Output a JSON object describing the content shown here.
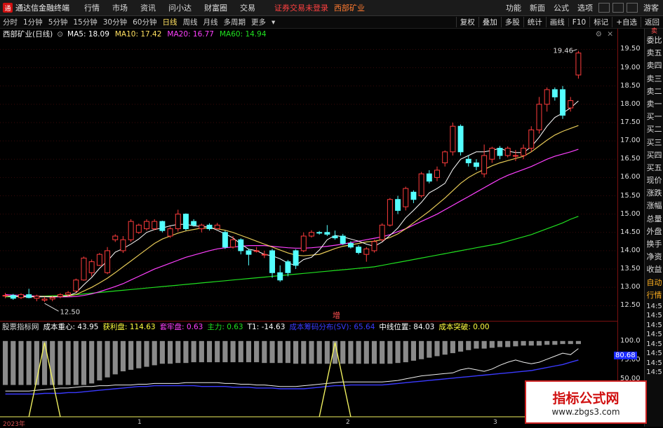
{
  "menubar": {
    "app_title": "通达信金融终端",
    "logo_glyph": "通",
    "items": [
      "行情",
      "市场",
      "资讯",
      "问小达",
      "财富圈",
      "交易"
    ],
    "notice": "证券交易未登录",
    "stock": "西部矿业",
    "right_items": [
      "功能",
      "新面",
      "公式",
      "选项"
    ],
    "guest": "游客"
  },
  "periods": {
    "items": [
      "分时",
      "1分钟",
      "5分钟",
      "15分钟",
      "30分钟",
      "60分钟",
      "日线",
      "周线",
      "月线",
      "多周期",
      "更多"
    ],
    "active_index": 6,
    "tools": [
      "复权",
      "叠加",
      "多股",
      "统计",
      "画线",
      "F10",
      "标记",
      "+自选",
      "返回"
    ]
  },
  "info": {
    "stock_label": "西部矿业(日线)",
    "ma5": "MA5: 18.09",
    "ma10": "MA10: 17.42",
    "ma20": "MA20: 16.77",
    "ma60": "MA60: 14.94",
    "colors": {
      "ma5": "#ffffff",
      "ma10": "#ffe060",
      "ma20": "#ff40ff",
      "ma60": "#20e020"
    }
  },
  "annotations": {
    "high": "19.46",
    "low": "12.50",
    "zeng": "增"
  },
  "y_ticks": [
    "19.50",
    "19.00",
    "18.50",
    "18.00",
    "17.50",
    "17.00",
    "16.50",
    "16.00",
    "15.50",
    "15.00",
    "14.50",
    "14.00",
    "13.50",
    "13.00",
    "12.50"
  ],
  "indicator": {
    "name": "股票指标网",
    "items": [
      {
        "text": "成本重心: 43.95",
        "color": "#ffffff"
      },
      {
        "text": "获利盘: 114.63",
        "color": "#ffff40"
      },
      {
        "text": "套牢盘: 0.63",
        "color": "#ff40ff"
      },
      {
        "text": "主力: 0.63",
        "color": "#20e020"
      },
      {
        "text": "T1: -14.63",
        "color": "#ffffff"
      },
      {
        "text": "成本筹码分布(SV): 65.64",
        "color": "#3a3aff"
      },
      {
        "text": "中线位置: 84.03",
        "color": "#ffffff"
      },
      {
        "text": "成本突破: 0.00",
        "color": "#ffff40"
      }
    ],
    "y_ticks": [
      "100.0",
      "75.00",
      "50.00"
    ],
    "current_value": "80.68"
  },
  "sidebar": {
    "header": "卖",
    "items": [
      "委比",
      "卖五",
      "卖四",
      "卖三",
      "卖二",
      "卖一",
      "买一",
      "买二",
      "买三",
      "买四",
      "买五",
      "现价",
      "涨跌",
      "涨幅",
      "总量",
      "外盘",
      "换手",
      "净资",
      "收益",
      "自动",
      "行情",
      "14:5",
      "14:5",
      "14:5",
      "14:5",
      "14:5",
      "14:5",
      "14:5",
      "14:5"
    ]
  },
  "x_labels": [
    "2023年",
    "1",
    "2",
    "3"
  ],
  "watermark": {
    "title": "指标公式网",
    "url": "www.zbgs3.com"
  },
  "chart_data": {
    "type": "candlestick",
    "ylim": [
      12.2,
      19.7
    ],
    "candles": [
      [
        12.78,
        12.78,
        12.85,
        12.7
      ],
      [
        12.78,
        12.7,
        12.82,
        12.66
      ],
      [
        12.72,
        12.8,
        12.84,
        12.68
      ],
      [
        12.8,
        12.72,
        12.96,
        12.7
      ],
      [
        12.7,
        12.76,
        12.8,
        12.62
      ],
      [
        12.65,
        12.68,
        12.74,
        12.6
      ],
      [
        12.68,
        12.72,
        12.76,
        12.62
      ],
      [
        12.75,
        12.8,
        12.84,
        12.7
      ],
      [
        12.8,
        12.85,
        12.9,
        12.74
      ],
      [
        12.9,
        13.2,
        13.24,
        12.86
      ],
      [
        13.2,
        13.8,
        13.84,
        13.18
      ],
      [
        13.4,
        13.7,
        13.76,
        13.3
      ],
      [
        13.6,
        13.9,
        13.94,
        13.58
      ],
      [
        13.4,
        14.0,
        14.1,
        13.36
      ],
      [
        14.3,
        14.4,
        14.45,
        14.24
      ],
      [
        14.0,
        14.3,
        14.4,
        13.94
      ],
      [
        14.3,
        14.8,
        14.86,
        14.24
      ],
      [
        14.5,
        14.7,
        14.74,
        14.46
      ],
      [
        14.6,
        14.8,
        14.86,
        14.55
      ],
      [
        14.6,
        14.8,
        14.86,
        14.56
      ],
      [
        14.8,
        14.55,
        14.82,
        14.5
      ],
      [
        14.4,
        14.6,
        14.66,
        14.35
      ],
      [
        14.6,
        15.0,
        15.12,
        14.52
      ],
      [
        15.0,
        14.6,
        15.02,
        14.55
      ],
      [
        14.8,
        14.7,
        14.86,
        14.66
      ],
      [
        14.6,
        14.7,
        14.74,
        14.5
      ],
      [
        14.7,
        14.6,
        14.75,
        14.55
      ],
      [
        14.6,
        14.7,
        14.76,
        14.58
      ],
      [
        14.5,
        14.1,
        14.55,
        14.05
      ],
      [
        14.1,
        14.3,
        14.4,
        14.06
      ],
      [
        14.3,
        14.0,
        14.34,
        13.9
      ],
      [
        14.0,
        13.9,
        14.05,
        13.6
      ],
      [
        14.0,
        14.0,
        14.1,
        13.95
      ],
      [
        13.9,
        13.9,
        14.0,
        13.8
      ],
      [
        14.0,
        13.4,
        14.05,
        13.26
      ],
      [
        13.4,
        13.2,
        13.6,
        13.15
      ],
      [
        13.7,
        13.4,
        13.75,
        13.3
      ],
      [
        14.0,
        13.6,
        14.04,
        13.5
      ],
      [
        14.0,
        14.4,
        14.5,
        13.96
      ],
      [
        14.4,
        14.5,
        14.56,
        14.36
      ],
      [
        14.5,
        14.48,
        14.54,
        14.44
      ],
      [
        14.5,
        14.45,
        14.7,
        14.4
      ],
      [
        14.4,
        14.35,
        14.55,
        14.3
      ],
      [
        14.4,
        14.2,
        14.46,
        14.16
      ],
      [
        14.2,
        14.1,
        14.26,
        14.06
      ],
      [
        14.1,
        13.95,
        14.15,
        13.9
      ],
      [
        13.9,
        14.05,
        14.1,
        13.7
      ],
      [
        14.0,
        14.25,
        14.3,
        13.95
      ],
      [
        14.3,
        14.7,
        14.75,
        14.25
      ],
      [
        14.7,
        15.4,
        15.44,
        14.66
      ],
      [
        15.4,
        15.1,
        15.5,
        15.0
      ],
      [
        15.2,
        15.7,
        15.75,
        15.1
      ],
      [
        15.6,
        15.4,
        15.65,
        15.3
      ],
      [
        15.5,
        16.1,
        16.15,
        15.45
      ],
      [
        16.1,
        15.9,
        16.2,
        15.84
      ],
      [
        16.0,
        16.2,
        16.3,
        15.9
      ],
      [
        16.4,
        16.7,
        16.74,
        16.3
      ],
      [
        16.7,
        17.4,
        17.5,
        16.6
      ],
      [
        17.4,
        16.7,
        17.45,
        16.6
      ],
      [
        16.5,
        16.4,
        16.6,
        16.3
      ],
      [
        16.4,
        16.3,
        16.5,
        16.2
      ],
      [
        16.1,
        16.6,
        16.9,
        16.0
      ],
      [
        16.5,
        16.8,
        16.84,
        16.4
      ],
      [
        16.8,
        16.6,
        16.86,
        16.5
      ],
      [
        16.6,
        16.8,
        16.85,
        16.55
      ],
      [
        16.6,
        16.6,
        16.75,
        16.45
      ],
      [
        16.6,
        16.8,
        16.9,
        16.5
      ],
      [
        16.8,
        17.3,
        17.4,
        16.7
      ],
      [
        17.3,
        18.0,
        18.2,
        17.2
      ],
      [
        18.0,
        18.4,
        18.46,
        17.8
      ],
      [
        18.4,
        18.2,
        18.46,
        18.1
      ],
      [
        18.4,
        17.7,
        18.5,
        17.6
      ],
      [
        17.9,
        18.1,
        18.2,
        17.8
      ],
      [
        18.8,
        19.4,
        19.46,
        18.7
      ]
    ],
    "ma5": [
      12.76,
      12.75,
      12.74,
      12.74,
      12.74,
      12.74,
      12.74,
      12.75,
      12.77,
      12.85,
      13.07,
      13.27,
      13.52,
      13.72,
      13.96,
      14.06,
      14.18,
      14.32,
      14.5,
      14.58,
      14.62,
      14.68,
      14.72,
      14.72,
      14.68,
      14.66,
      14.65,
      14.56,
      14.46,
      14.35,
      14.18,
      14.04,
      14.0,
      13.9,
      13.86,
      13.78,
      13.66,
      13.6,
      13.76,
      13.82,
      14.02,
      14.3,
      14.42,
      14.38,
      14.32,
      14.26,
      14.18,
      14.12,
      14.24,
      14.42,
      14.62,
      14.9,
      15.1,
      15.32,
      15.58,
      15.7,
      15.84,
      16.22,
      16.5,
      16.6,
      16.7,
      16.7,
      16.74,
      16.8,
      16.72,
      16.68,
      16.68,
      16.84,
      17.1,
      17.4,
      17.64,
      17.76,
      17.9,
      18.09
    ],
    "ma10": [
      12.76,
      12.76,
      12.75,
      12.75,
      12.75,
      12.75,
      12.75,
      12.75,
      12.76,
      12.8,
      12.9,
      13.0,
      13.12,
      13.25,
      13.4,
      13.56,
      13.72,
      13.88,
      14.04,
      14.2,
      14.32,
      14.4,
      14.48,
      14.54,
      14.58,
      14.62,
      14.62,
      14.6,
      14.56,
      14.5,
      14.42,
      14.34,
      14.26,
      14.18,
      14.1,
      14.02,
      13.94,
      13.88,
      13.86,
      13.88,
      13.9,
      13.98,
      14.06,
      14.12,
      14.16,
      14.2,
      14.24,
      14.26,
      14.3,
      14.36,
      14.46,
      14.6,
      14.76,
      14.92,
      15.08,
      15.26,
      15.44,
      15.64,
      15.84,
      16.0,
      16.12,
      16.22,
      16.32,
      16.4,
      16.46,
      16.52,
      16.58,
      16.7,
      16.86,
      17.02,
      17.16,
      17.26,
      17.34,
      17.42
    ],
    "ma20": [
      12.8,
      12.79,
      12.78,
      12.77,
      12.76,
      12.75,
      12.74,
      12.74,
      12.74,
      12.75,
      12.78,
      12.82,
      12.88,
      12.95,
      13.02,
      13.1,
      13.2,
      13.3,
      13.4,
      13.5,
      13.58,
      13.66,
      13.74,
      13.82,
      13.88,
      13.94,
      14.0,
      14.05,
      14.08,
      14.1,
      14.12,
      14.14,
      14.14,
      14.14,
      14.12,
      14.1,
      14.08,
      14.07,
      14.07,
      14.08,
      14.1,
      14.12,
      14.15,
      14.18,
      14.22,
      14.26,
      14.3,
      14.34,
      14.38,
      14.44,
      14.52,
      14.6,
      14.7,
      14.8,
      14.9,
      15.0,
      15.12,
      15.24,
      15.36,
      15.48,
      15.6,
      15.72,
      15.84,
      15.96,
      16.06,
      16.14,
      16.22,
      16.3,
      16.4,
      16.5,
      16.58,
      16.64,
      16.7,
      16.77
    ],
    "ma60": [
      12.74,
      12.74,
      12.75,
      12.75,
      12.76,
      12.76,
      12.77,
      12.78,
      12.79,
      12.8,
      12.82,
      12.84,
      12.86,
      12.88,
      12.9,
      12.92,
      12.94,
      12.96,
      12.98,
      13.0,
      13.02,
      13.04,
      13.06,
      13.08,
      13.1,
      13.12,
      13.14,
      13.16,
      13.18,
      13.2,
      13.22,
      13.24,
      13.26,
      13.28,
      13.3,
      13.32,
      13.34,
      13.36,
      13.38,
      13.4,
      13.42,
      13.44,
      13.46,
      13.48,
      13.5,
      13.52,
      13.54,
      13.56,
      13.6,
      13.64,
      13.68,
      13.72,
      13.76,
      13.8,
      13.84,
      13.88,
      13.92,
      13.96,
      14.0,
      14.04,
      14.08,
      14.12,
      14.16,
      14.2,
      14.26,
      14.32,
      14.38,
      14.44,
      14.52,
      14.6,
      14.68,
      14.76,
      14.86,
      14.94
    ],
    "sub_bars": [
      58,
      58,
      58,
      58,
      58,
      58,
      58,
      58,
      58,
      58,
      58,
      56,
      52,
      48,
      44,
      40,
      38,
      36,
      34,
      32,
      30,
      30,
      29,
      29,
      28,
      28,
      28,
      28,
      28,
      28,
      28,
      28,
      28,
      29,
      29,
      29,
      29,
      30,
      30,
      30,
      30,
      30,
      30,
      30,
      30,
      30,
      30,
      30,
      30,
      30,
      29,
      28,
      26,
      24,
      22,
      20,
      18,
      16,
      14,
      12,
      10,
      10,
      9,
      8,
      8,
      7,
      6,
      6,
      6,
      5,
      5,
      4,
      4,
      4
    ],
    "sub_white": [
      34,
      34,
      34,
      34,
      35,
      36,
      37,
      38,
      38,
      39,
      40,
      40,
      41,
      41,
      42,
      42,
      42,
      43,
      43,
      44,
      44,
      44,
      44,
      45,
      45,
      45,
      45,
      45,
      44,
      44,
      43,
      43,
      42,
      42,
      41,
      40,
      40,
      40,
      41,
      42,
      43,
      44,
      45,
      46,
      46,
      46,
      46,
      46,
      46,
      47,
      48,
      50,
      52,
      54,
      55,
      56,
      57,
      58,
      62,
      64,
      62,
      60,
      63,
      68,
      72,
      75,
      72,
      70,
      72,
      76,
      80,
      84,
      82,
      90
    ],
    "sub_blue": [
      30,
      30,
      30,
      30,
      30,
      31,
      31,
      31,
      32,
      32,
      33,
      34,
      35,
      36,
      37,
      38,
      39,
      40,
      40,
      41,
      41,
      41,
      41,
      41,
      41,
      40,
      40,
      40,
      40,
      39,
      39,
      39,
      38,
      38,
      38,
      37,
      37,
      37,
      37,
      38,
      39,
      40,
      41,
      41,
      42,
      42,
      42,
      42,
      42,
      43,
      44,
      45,
      46,
      47,
      48,
      49,
      50,
      51,
      52,
      53,
      54,
      55,
      56,
      57,
      58,
      59,
      60,
      61,
      63,
      65,
      67,
      69,
      72,
      75
    ],
    "spikes": [
      {
        "index": 5,
        "value": 98
      },
      {
        "index": 42,
        "value": 98
      }
    ],
    "sub_ylim": [
      0,
      110
    ]
  }
}
